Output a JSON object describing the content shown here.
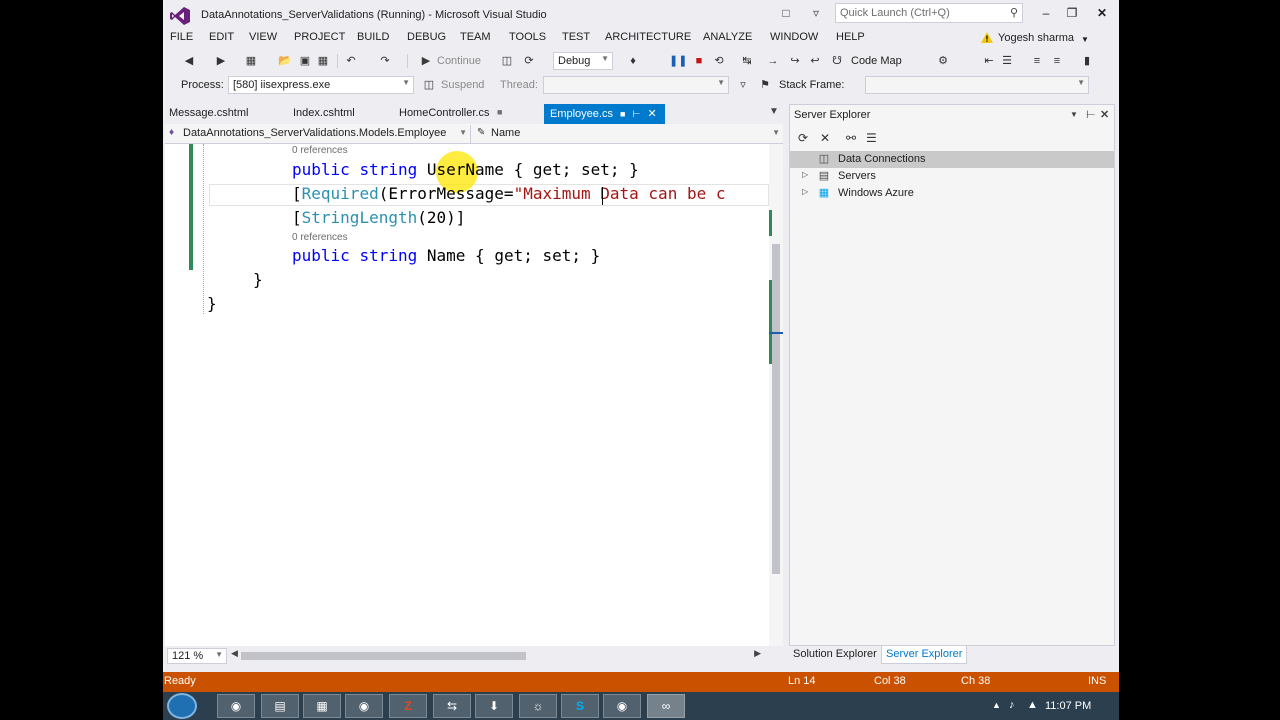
{
  "window": {
    "title": "DataAnnotations_ServerValidations (Running) - Microsoft Visual Studio",
    "quick_launch_placeholder": "Quick Launch (Ctrl+Q)"
  },
  "menu": [
    "FILE",
    "EDIT",
    "VIEW",
    "PROJECT",
    "BUILD",
    "DEBUG",
    "TEAM",
    "TOOLS",
    "TEST",
    "ARCHITECTURE",
    "ANALYZE",
    "WINDOW",
    "HELP"
  ],
  "user": {
    "name": "Yogesh sharma"
  },
  "toolbar": {
    "continue_label": "Continue",
    "config_value": "Debug",
    "code_map_label": "Code Map",
    "process_label": "Process:",
    "process_value": "[580] iisexpress.exe",
    "suspend_label": "Suspend",
    "thread_label": "Thread:",
    "stack_frame_label": "Stack Frame:"
  },
  "tabs": [
    {
      "label": "Message.cshtml",
      "active": false
    },
    {
      "label": "Index.cshtml",
      "active": false
    },
    {
      "label": "HomeController.cs",
      "active": false
    },
    {
      "label": "Employee.cs",
      "active": true
    }
  ],
  "navbar": {
    "class_value": "DataAnnotations_ServerValidations.Models.Employee",
    "member_value": "Name"
  },
  "code": {
    "codelens1": "0 references",
    "line1": {
      "kw1": "public",
      "kw2": "string",
      "ident": "UserName",
      "rest": "{ get; set; }"
    },
    "line2": {
      "open": "[",
      "attr": "Required",
      "mid": "(ErrorMessage=",
      "str": "\"Maximum Data can be c"
    },
    "line3": {
      "open": "[",
      "attr": "StringLength",
      "rest": "(20)]"
    },
    "codelens2": "0 references",
    "line4": {
      "kw1": "public",
      "kw2": "string",
      "ident": "Name",
      "rest": "{ get; set; }"
    },
    "brace1": "}",
    "brace2": "}"
  },
  "editor": {
    "zoom": "121 %"
  },
  "server_explorer": {
    "title": "Server Explorer",
    "nodes": [
      {
        "label": "Data Connections",
        "selected": true
      },
      {
        "label": "Servers",
        "selected": false
      },
      {
        "label": "Windows Azure",
        "selected": false
      }
    ],
    "bottom_tabs": [
      {
        "label": "Solution Explorer",
        "active": false
      },
      {
        "label": "Server Explorer",
        "active": true
      }
    ]
  },
  "status": {
    "state": "Ready",
    "line": "Ln 14",
    "col": "Col 38",
    "ch": "Ch 38",
    "mode": "INS"
  },
  "taskbar": {
    "time": "11:07 PM"
  },
  "colors": {
    "accent": "#007acc",
    "status_debug": "#ca5100",
    "keyword": "#0000ff",
    "type": "#2b91af",
    "string": "#a31515"
  }
}
